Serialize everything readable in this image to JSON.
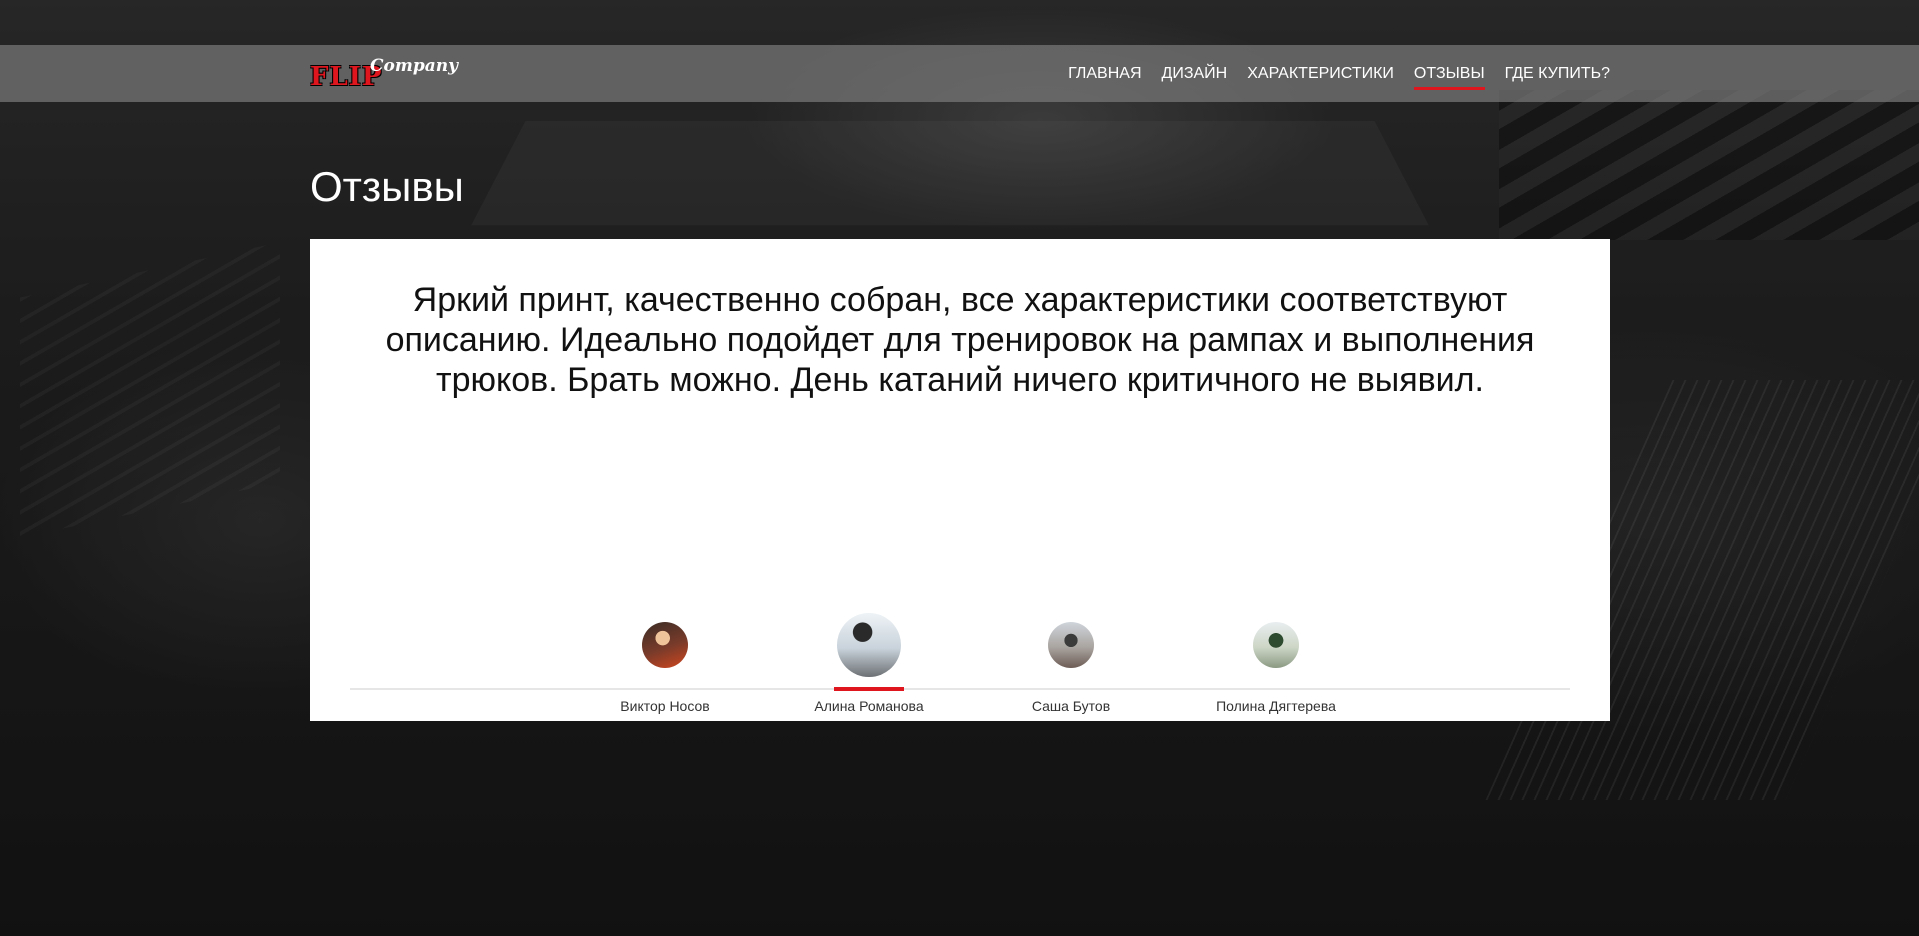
{
  "header": {
    "logo": {
      "brand": "FLIP",
      "company": "Company"
    },
    "nav": [
      {
        "label": "ГЛАВНАЯ",
        "active": false
      },
      {
        "label": "ДИЗАЙН",
        "active": false
      },
      {
        "label": "ХАРАКТЕРИСТИКИ",
        "active": false
      },
      {
        "label": "ОТЗЫВЫ",
        "active": true
      },
      {
        "label": "ГДЕ КУПИТЬ?",
        "active": false
      }
    ]
  },
  "reviews": {
    "title": "Отзывы",
    "current_quote": "Яркий принт, качественно собран, все характеристики соответствуют описанию. Идеально подойдет для тренировок на рампах и выполнения трюков. Брать можно. День катаний ничего критичного не выявил.",
    "reviewers": [
      {
        "name": "Виктор Носов",
        "active": false
      },
      {
        "name": "Алина Романова",
        "active": true
      },
      {
        "name": "Саша Бутов",
        "active": false
      },
      {
        "name": "Полина Дягтерева",
        "active": false
      }
    ]
  },
  "colors": {
    "accent": "#e0161f",
    "card_background": "#ffffff",
    "header_background": "#787878"
  }
}
